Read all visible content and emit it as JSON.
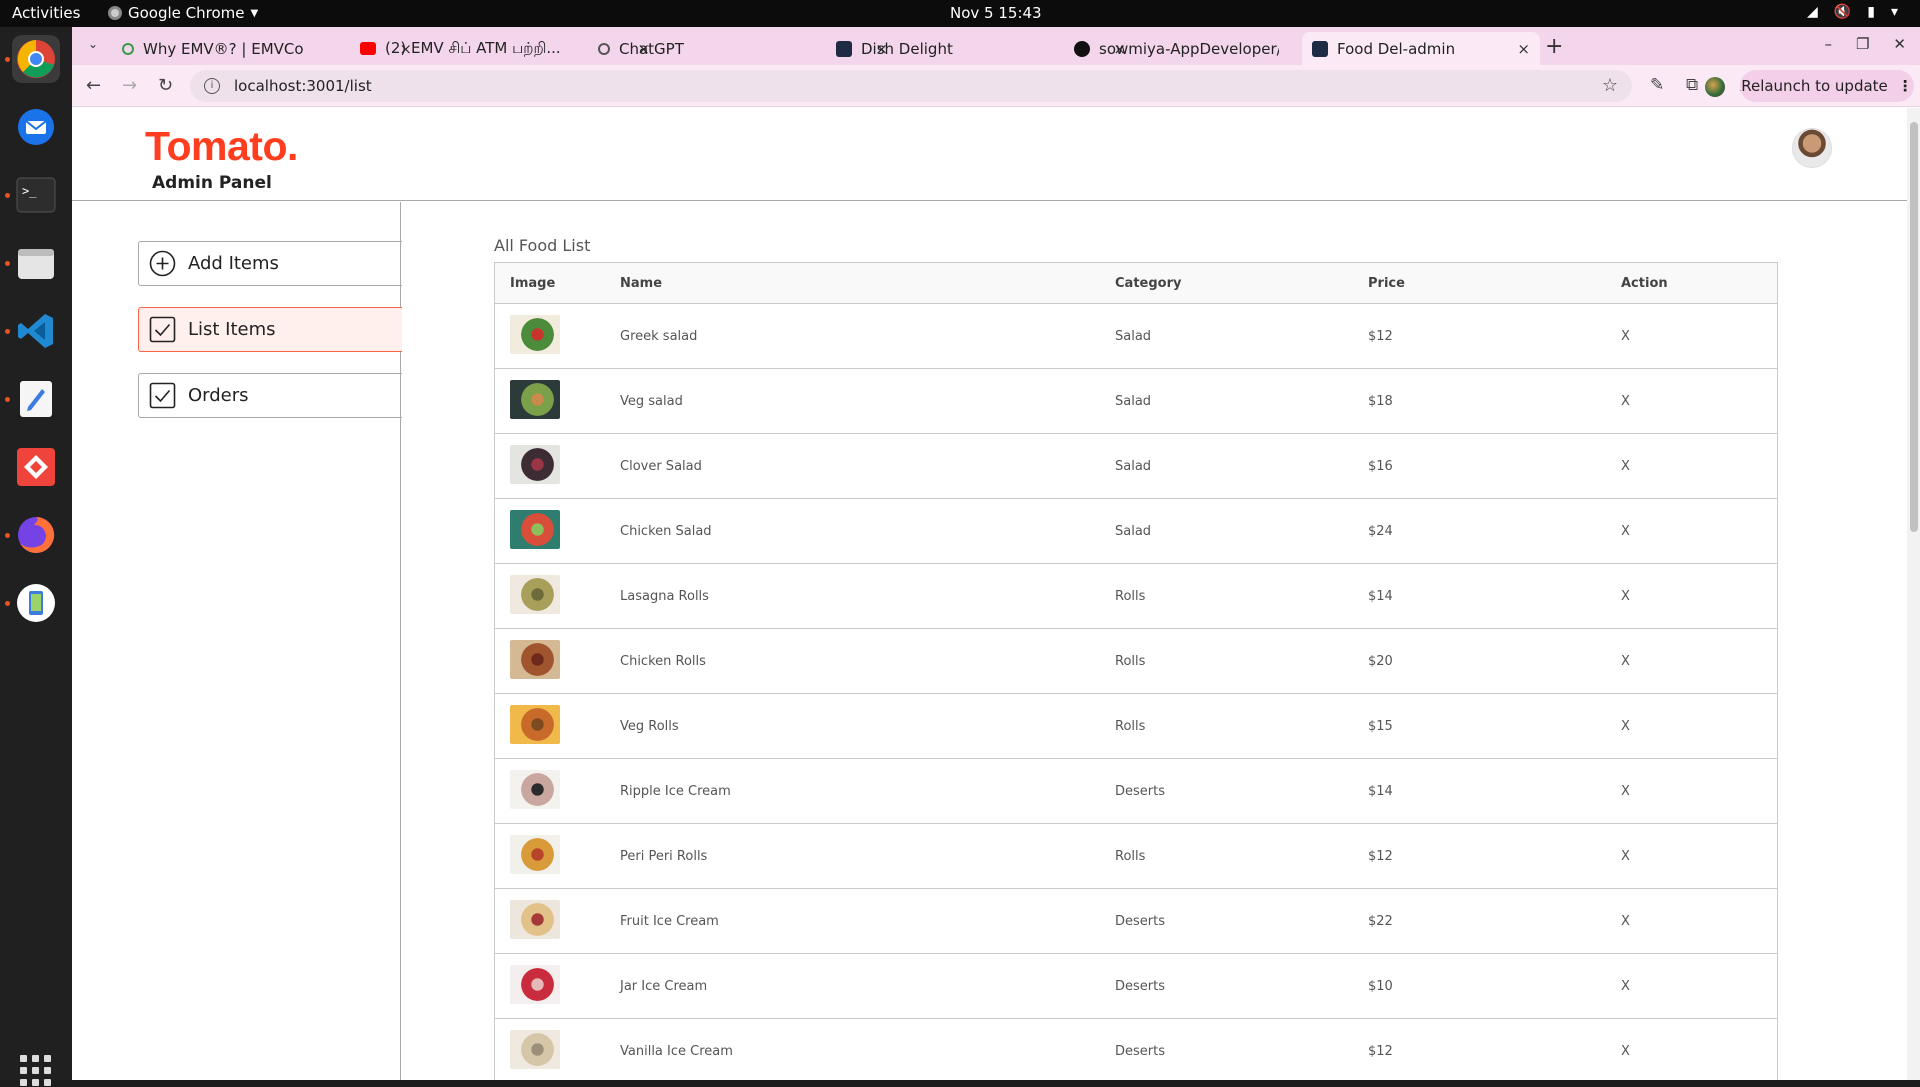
{
  "system": {
    "activities": "Activities",
    "app_name": "Google Chrome",
    "clock": "Nov 5  15:43"
  },
  "tabs": [
    {
      "title": "Why EMV®? | EMVCo",
      "favicon_color": "#ffffff",
      "active": false
    },
    {
      "title": "(2) EMV சிப் ATM பற்றி...",
      "favicon_color": "#ff0000",
      "active": false
    },
    {
      "title": "ChatGPT",
      "favicon_color": "#ffffff",
      "active": false
    },
    {
      "title": "Dish Delight",
      "favicon_color": "#1f2a44",
      "active": false
    },
    {
      "title": "sowmiya-AppDeveloper/",
      "favicon_color": "#111111",
      "active": false
    },
    {
      "title": "Food Del-admin",
      "favicon_color": "#1f2a44",
      "active": true
    }
  ],
  "toolbar": {
    "url": "localhost:3001/list",
    "relaunch_label": "Relaunch to update"
  },
  "header": {
    "logo": "Tomato.",
    "subtitle": "Admin Panel"
  },
  "sidebar": {
    "items": [
      {
        "label": "Add Items",
        "icon": "plus-circle-icon",
        "active": false
      },
      {
        "label": "List Items",
        "icon": "checkbox-icon",
        "active": true
      },
      {
        "label": "Orders",
        "icon": "checkbox-icon",
        "active": false
      }
    ]
  },
  "list": {
    "title": "All Food List",
    "columns": [
      "Image",
      "Name",
      "Category",
      "Price",
      "Action"
    ],
    "rows": [
      {
        "name": "Greek salad",
        "category": "Salad",
        "price": "$12",
        "action": "X",
        "img_colors": [
          "#f2ecdf",
          "#4c8b3a",
          "#c8352c"
        ]
      },
      {
        "name": "Veg salad",
        "category": "Salad",
        "price": "$18",
        "action": "X",
        "img_colors": [
          "#2c3a3a",
          "#7aa04a",
          "#c98b4b"
        ]
      },
      {
        "name": "Clover Salad",
        "category": "Salad",
        "price": "$16",
        "action": "X",
        "img_colors": [
          "#e4e4e0",
          "#3e2c35",
          "#9a3546"
        ]
      },
      {
        "name": "Chicken Salad",
        "category": "Salad",
        "price": "$24",
        "action": "X",
        "img_colors": [
          "#2f7d6e",
          "#d94d3b",
          "#8fbf5a"
        ]
      },
      {
        "name": "Lasagna Rolls",
        "category": "Rolls",
        "price": "$14",
        "action": "X",
        "img_colors": [
          "#efe9df",
          "#a8a05a",
          "#6e6a3a"
        ]
      },
      {
        "name": "Chicken Rolls",
        "category": "Rolls",
        "price": "$20",
        "action": "X",
        "img_colors": [
          "#d5b894",
          "#a1552e",
          "#6d2a1a"
        ]
      },
      {
        "name": "Veg Rolls",
        "category": "Rolls",
        "price": "$15",
        "action": "X",
        "img_colors": [
          "#f1b84a",
          "#c86b2a",
          "#7e4a20"
        ]
      },
      {
        "name": "Ripple Ice Cream",
        "category": "Deserts",
        "price": "$14",
        "action": "X",
        "img_colors": [
          "#f4f2ef",
          "#c9a6a0",
          "#2b2b2b"
        ]
      },
      {
        "name": "Peri Peri Rolls",
        "category": "Rolls",
        "price": "$12",
        "action": "X",
        "img_colors": [
          "#f2f0ea",
          "#d99a3a",
          "#b7432a"
        ]
      },
      {
        "name": "Fruit Ice Cream",
        "category": "Deserts",
        "price": "$22",
        "action": "X",
        "img_colors": [
          "#ece6dc",
          "#e3c28a",
          "#a43a3a"
        ]
      },
      {
        "name": "Jar Ice Cream",
        "category": "Deserts",
        "price": "$10",
        "action": "X",
        "img_colors": [
          "#f5eeee",
          "#c92c3c",
          "#e7b8b8"
        ]
      },
      {
        "name": "Vanilla Ice Cream",
        "category": "Deserts",
        "price": "$12",
        "action": "X",
        "img_colors": [
          "#efe9df",
          "#d6c6a8",
          "#9b8f7a"
        ]
      }
    ]
  }
}
